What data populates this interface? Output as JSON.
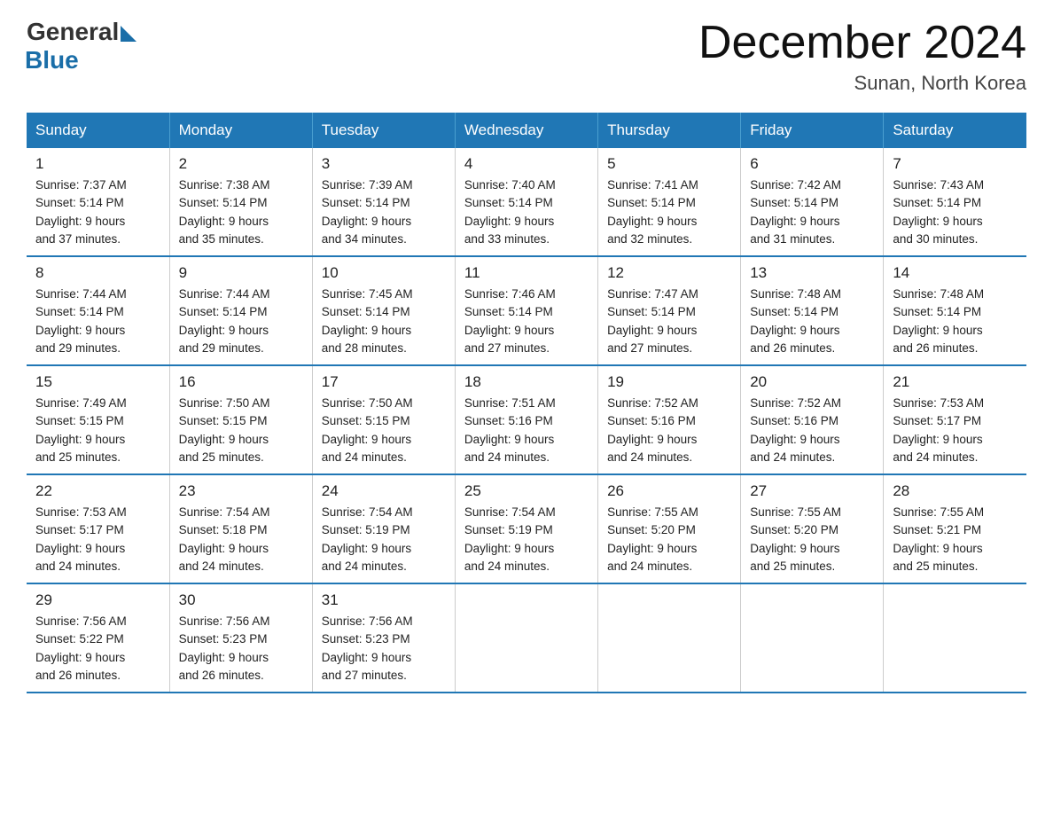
{
  "logo": {
    "general": "General",
    "blue": "Blue"
  },
  "title": "December 2024",
  "location": "Sunan, North Korea",
  "days_of_week": [
    "Sunday",
    "Monday",
    "Tuesday",
    "Wednesday",
    "Thursday",
    "Friday",
    "Saturday"
  ],
  "weeks": [
    [
      {
        "day": "1",
        "sunrise": "7:37 AM",
        "sunset": "5:14 PM",
        "daylight": "9 hours and 37 minutes."
      },
      {
        "day": "2",
        "sunrise": "7:38 AM",
        "sunset": "5:14 PM",
        "daylight": "9 hours and 35 minutes."
      },
      {
        "day": "3",
        "sunrise": "7:39 AM",
        "sunset": "5:14 PM",
        "daylight": "9 hours and 34 minutes."
      },
      {
        "day": "4",
        "sunrise": "7:40 AM",
        "sunset": "5:14 PM",
        "daylight": "9 hours and 33 minutes."
      },
      {
        "day": "5",
        "sunrise": "7:41 AM",
        "sunset": "5:14 PM",
        "daylight": "9 hours and 32 minutes."
      },
      {
        "day": "6",
        "sunrise": "7:42 AM",
        "sunset": "5:14 PM",
        "daylight": "9 hours and 31 minutes."
      },
      {
        "day": "7",
        "sunrise": "7:43 AM",
        "sunset": "5:14 PM",
        "daylight": "9 hours and 30 minutes."
      }
    ],
    [
      {
        "day": "8",
        "sunrise": "7:44 AM",
        "sunset": "5:14 PM",
        "daylight": "9 hours and 29 minutes."
      },
      {
        "day": "9",
        "sunrise": "7:44 AM",
        "sunset": "5:14 PM",
        "daylight": "9 hours and 29 minutes."
      },
      {
        "day": "10",
        "sunrise": "7:45 AM",
        "sunset": "5:14 PM",
        "daylight": "9 hours and 28 minutes."
      },
      {
        "day": "11",
        "sunrise": "7:46 AM",
        "sunset": "5:14 PM",
        "daylight": "9 hours and 27 minutes."
      },
      {
        "day": "12",
        "sunrise": "7:47 AM",
        "sunset": "5:14 PM",
        "daylight": "9 hours and 27 minutes."
      },
      {
        "day": "13",
        "sunrise": "7:48 AM",
        "sunset": "5:14 PM",
        "daylight": "9 hours and 26 minutes."
      },
      {
        "day": "14",
        "sunrise": "7:48 AM",
        "sunset": "5:14 PM",
        "daylight": "9 hours and 26 minutes."
      }
    ],
    [
      {
        "day": "15",
        "sunrise": "7:49 AM",
        "sunset": "5:15 PM",
        "daylight": "9 hours and 25 minutes."
      },
      {
        "day": "16",
        "sunrise": "7:50 AM",
        "sunset": "5:15 PM",
        "daylight": "9 hours and 25 minutes."
      },
      {
        "day": "17",
        "sunrise": "7:50 AM",
        "sunset": "5:15 PM",
        "daylight": "9 hours and 24 minutes."
      },
      {
        "day": "18",
        "sunrise": "7:51 AM",
        "sunset": "5:16 PM",
        "daylight": "9 hours and 24 minutes."
      },
      {
        "day": "19",
        "sunrise": "7:52 AM",
        "sunset": "5:16 PM",
        "daylight": "9 hours and 24 minutes."
      },
      {
        "day": "20",
        "sunrise": "7:52 AM",
        "sunset": "5:16 PM",
        "daylight": "9 hours and 24 minutes."
      },
      {
        "day": "21",
        "sunrise": "7:53 AM",
        "sunset": "5:17 PM",
        "daylight": "9 hours and 24 minutes."
      }
    ],
    [
      {
        "day": "22",
        "sunrise": "7:53 AM",
        "sunset": "5:17 PM",
        "daylight": "9 hours and 24 minutes."
      },
      {
        "day": "23",
        "sunrise": "7:54 AM",
        "sunset": "5:18 PM",
        "daylight": "9 hours and 24 minutes."
      },
      {
        "day": "24",
        "sunrise": "7:54 AM",
        "sunset": "5:19 PM",
        "daylight": "9 hours and 24 minutes."
      },
      {
        "day": "25",
        "sunrise": "7:54 AM",
        "sunset": "5:19 PM",
        "daylight": "9 hours and 24 minutes."
      },
      {
        "day": "26",
        "sunrise": "7:55 AM",
        "sunset": "5:20 PM",
        "daylight": "9 hours and 24 minutes."
      },
      {
        "day": "27",
        "sunrise": "7:55 AM",
        "sunset": "5:20 PM",
        "daylight": "9 hours and 25 minutes."
      },
      {
        "day": "28",
        "sunrise": "7:55 AM",
        "sunset": "5:21 PM",
        "daylight": "9 hours and 25 minutes."
      }
    ],
    [
      {
        "day": "29",
        "sunrise": "7:56 AM",
        "sunset": "5:22 PM",
        "daylight": "9 hours and 26 minutes."
      },
      {
        "day": "30",
        "sunrise": "7:56 AM",
        "sunset": "5:23 PM",
        "daylight": "9 hours and 26 minutes."
      },
      {
        "day": "31",
        "sunrise": "7:56 AM",
        "sunset": "5:23 PM",
        "daylight": "9 hours and 27 minutes."
      },
      null,
      null,
      null,
      null
    ]
  ],
  "labels": {
    "sunrise_prefix": "Sunrise: ",
    "sunset_prefix": "Sunset: ",
    "daylight_prefix": "Daylight: "
  }
}
